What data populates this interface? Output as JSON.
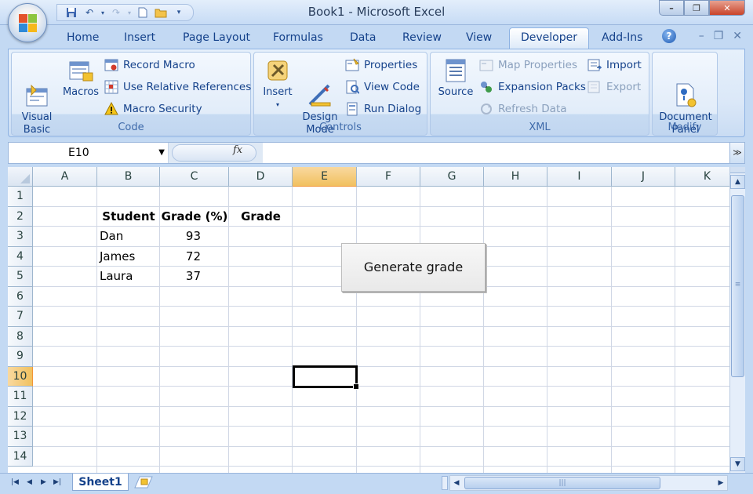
{
  "window": {
    "title": "Book1  -  Microsoft Excel",
    "minimize": "–",
    "restore": "❐",
    "close": "✕"
  },
  "tabs": [
    {
      "label": "Home"
    },
    {
      "label": "Insert"
    },
    {
      "label": "Page Layout"
    },
    {
      "label": "Formulas"
    },
    {
      "label": "Data"
    },
    {
      "label": "Review"
    },
    {
      "label": "View"
    },
    {
      "label": "Developer"
    },
    {
      "label": "Add-Ins"
    }
  ],
  "active_tab": "Developer",
  "help_icon": "?",
  "doc_controls": {
    "minimize": "–",
    "restore": "❐",
    "close": "✕"
  },
  "ribbon": {
    "code": {
      "label": "Code",
      "visual_basic": "Visual\nBasic",
      "macros": "Macros",
      "record_macro": "Record Macro",
      "relative_refs": "Use Relative References",
      "macro_security": "Macro Security"
    },
    "controls": {
      "label": "Controls",
      "insert": "Insert",
      "design_mode": "Design\nMode",
      "properties": "Properties",
      "view_code": "View Code",
      "run_dialog": "Run Dialog"
    },
    "xml": {
      "label": "XML",
      "source": "Source",
      "map_properties": "Map Properties",
      "expansion_packs": "Expansion Packs",
      "refresh_data": "Refresh Data",
      "import": "Import",
      "export": "Export"
    },
    "modify": {
      "label": "Modify",
      "document_panel": "Document\nPanel"
    }
  },
  "formula_bar": {
    "name_box": "E10",
    "fx": "fx",
    "formula": ""
  },
  "columns": [
    "A",
    "B",
    "C",
    "D",
    "E",
    "F",
    "G",
    "H",
    "I",
    "J",
    "K"
  ],
  "selected_column": "E",
  "rows": [
    "1",
    "2",
    "3",
    "4",
    "5",
    "6",
    "7",
    "8",
    "9",
    "10",
    "11",
    "12",
    "13",
    "14"
  ],
  "selected_row": "10",
  "cells": {
    "B2": "Student",
    "C2": "Grade (%)",
    "D2": "Grade",
    "B3": "Dan",
    "C3": "93",
    "B4": "James",
    "C4": "72",
    "B5": "Laura",
    "C5": "37"
  },
  "form_button": "Generate grade",
  "sheet_tabs": {
    "active": "Sheet1"
  },
  "colors": {
    "ribbon_bg": "#dbe8f8",
    "selected_header": "#f1c15f",
    "accent": "#15428b"
  }
}
